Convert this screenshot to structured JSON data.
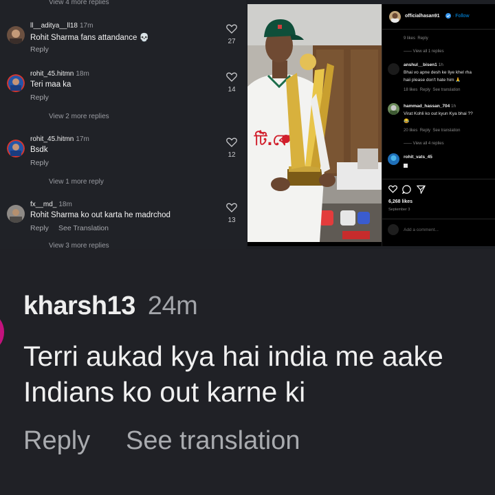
{
  "left_panel": {
    "view_more_top": "View 4 more replies",
    "view_more_bottom": "View 3 more replies",
    "comments": [
      {
        "username": "ll__aditya__ll18",
        "time": "17m",
        "text": "Rohit Sharma fans attandance 💀",
        "reply": "Reply",
        "see_translation": "",
        "likes": "27"
      },
      {
        "username": "rohit_45.hitmn",
        "time": "18m",
        "text": "Teri maa ka",
        "reply": "Reply",
        "see_translation": "",
        "likes": "14",
        "view_more": "View 2 more replies"
      },
      {
        "username": "rohit_45.hitmn",
        "time": "17m",
        "text": "Bsdk",
        "reply": "Reply",
        "see_translation": "",
        "likes": "12",
        "view_more": "View 1 more reply"
      },
      {
        "username": "fx__md_",
        "time": "18m",
        "text": "Rohit Sharma ko out karta he madrchod",
        "reply": "Reply",
        "see_translation": "See Translation",
        "likes": "13"
      }
    ]
  },
  "post": {
    "author": "officialhasan91",
    "follow": "Follow",
    "top_meta": {
      "likes": "9 likes",
      "reply": "Reply"
    },
    "view_replies_1": "View all 1 replies",
    "comments": [
      {
        "username": "anshul__bisen1",
        "time": "1h",
        "text_line1": "Bhai vo apne desh ke liye khel rha",
        "text_line2": "haii please don't hate him 🙏",
        "likes": "18 likes",
        "reply": "Reply",
        "see_translation": "See translation"
      },
      {
        "username": "hammad_hassan_704",
        "time": "1h",
        "text_line1": "Virat Kohli ko out kyun Kya bhai ??",
        "text_line2": "😂",
        "likes": "20 likes",
        "reply": "Reply",
        "see_translation": "See translation"
      }
    ],
    "view_replies_4": "View all 4 replies",
    "last_commenter": "rohit_vats_45",
    "likes_total": "6,268 likes",
    "date": "September 3",
    "add_comment_placeholder": "Add a comment...",
    "shirt_logo": "টি.কে"
  },
  "bottom": {
    "username": "kharsh13",
    "time": "24m",
    "text_line1": "Terri aukad kya hai india me aake",
    "text_line2": "Indians ko out karne ki",
    "reply": "Reply",
    "see_translation": "See translation"
  },
  "colors": {
    "background": "#1d1f24",
    "accent": "#c3127d",
    "muted_text": "#a6a8ad",
    "follow_blue": "#0095f6"
  }
}
